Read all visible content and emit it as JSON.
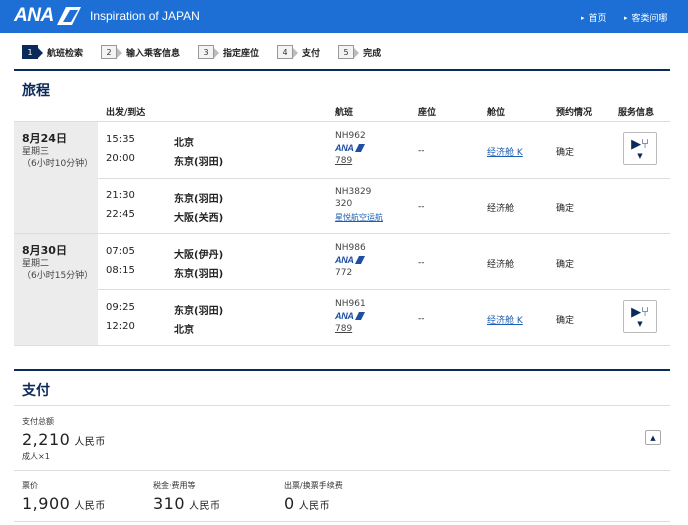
{
  "header": {
    "logo": "ANA",
    "tagline": "Inspiration of JAPAN",
    "links": [
      "首页",
      "客类问哪"
    ]
  },
  "steps": [
    {
      "num": "1",
      "label": "航班检索",
      "active": true
    },
    {
      "num": "2",
      "label": "输入乘客信息",
      "active": false
    },
    {
      "num": "3",
      "label": "指定座位",
      "active": false
    },
    {
      "num": "4",
      "label": "支付",
      "active": false
    },
    {
      "num": "5",
      "label": "完成",
      "active": false
    }
  ],
  "itinerary": {
    "title": "旅程",
    "columns": {
      "depart_arrive": "出发/到达",
      "flight": "航班",
      "seat": "座位",
      "cabin": "舱位",
      "booking": "预约情况",
      "service": "服务信息"
    },
    "days": [
      {
        "date": "8月24日",
        "weekday": "星期三",
        "duration": "（6小时10分钟）"
      },
      {
        "date": "8月30日",
        "weekday": "星期二",
        "duration": "（6小时15分钟）"
      }
    ],
    "segments": [
      {
        "dep_time": "15:35",
        "dep_city": "北京",
        "arr_time": "20:00",
        "arr_city": "东京(羽田)",
        "flight_no": "NH962",
        "carrier_logo": "ANA",
        "aircraft": "789",
        "aircraft_link": true,
        "seat": "--",
        "cabin": "经济舱 K",
        "cabin_link": true,
        "status": "确定",
        "service": true
      },
      {
        "dep_time": "21:30",
        "dep_city": "东京(羽田)",
        "arr_time": "22:45",
        "arr_city": "大阪(关西)",
        "flight_no": "NH3829",
        "aircraft": "320",
        "operator": "星悦航空运航",
        "seat": "--",
        "cabin": "经济舱",
        "cabin_link": false,
        "status": "确定",
        "service": false
      },
      {
        "dep_time": "07:05",
        "dep_city": "大阪(伊丹)",
        "arr_time": "08:15",
        "arr_city": "东京(羽田)",
        "flight_no": "NH986",
        "carrier_logo": "ANA",
        "aircraft": "772",
        "aircraft_link": false,
        "seat": "--",
        "cabin": "经济舱",
        "cabin_link": false,
        "status": "确定",
        "service": false
      },
      {
        "dep_time": "09:25",
        "dep_city": "东京(羽田)",
        "arr_time": "12:20",
        "arr_city": "北京",
        "flight_no": "NH961",
        "carrier_logo": "ANA",
        "aircraft": "789",
        "aircraft_link": true,
        "seat": "--",
        "cabin": "经济舱 K",
        "cabin_link": true,
        "status": "确定",
        "service": true
      }
    ]
  },
  "payment": {
    "title": "支付",
    "total_label": "支付总额",
    "total_amount": "2,210",
    "currency": "人民币",
    "pax": "成人×1",
    "breakdown": [
      {
        "label": "票价",
        "amount": "1,900"
      },
      {
        "label": "税金·费用等",
        "amount": "310"
      },
      {
        "label": "出票/换票手续费",
        "amount": "0"
      }
    ]
  },
  "colors": {
    "brand": "#1d6fd6",
    "navy": "#0a2a5a",
    "link": "#1a5fb4"
  }
}
